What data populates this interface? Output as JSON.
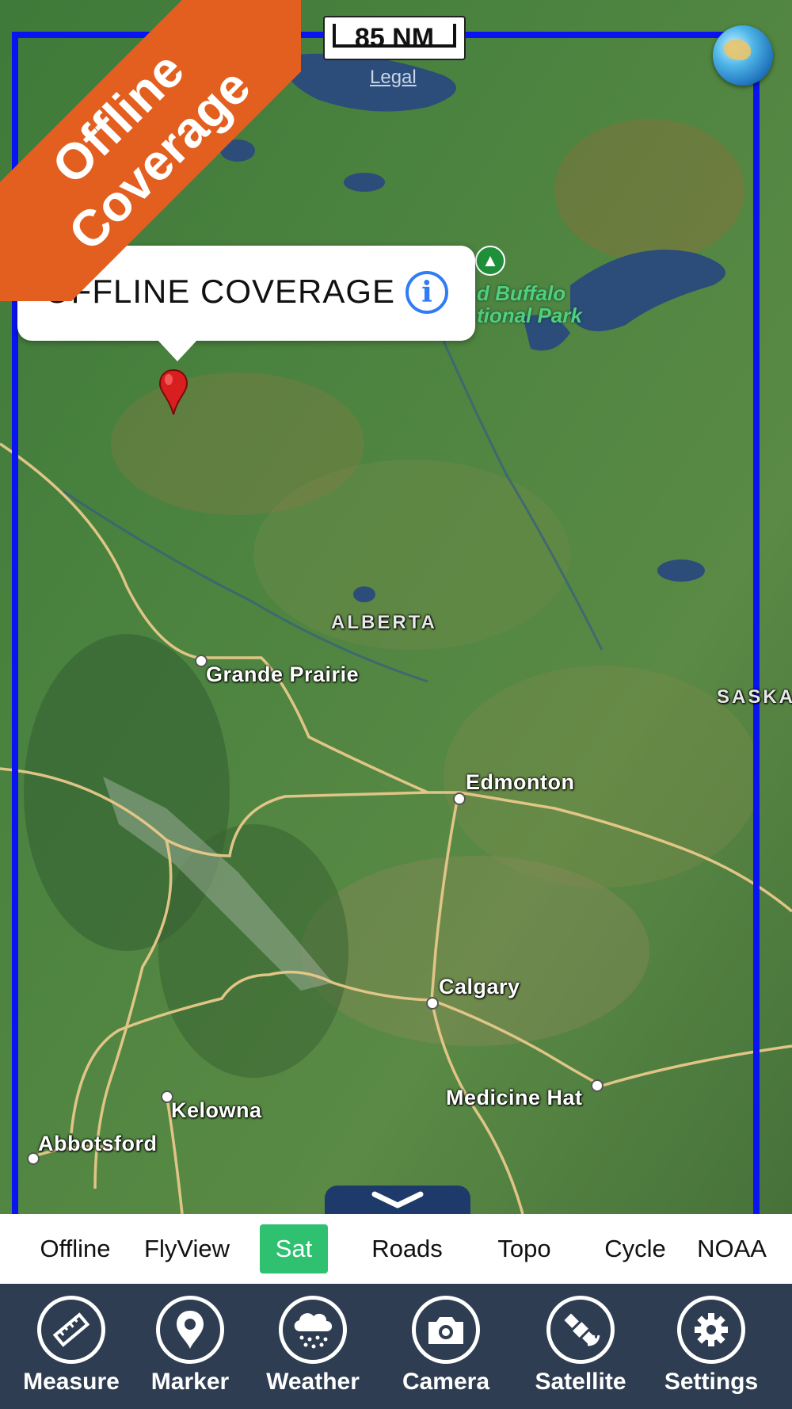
{
  "map": {
    "scale_label": "85 NM",
    "legal_label": "Legal",
    "ribbon_lines": [
      "Offline",
      "Coverage"
    ],
    "callout_title": "OFFLINE COVERAGE",
    "info_label": "i",
    "province_label": "ALBERTA",
    "province_label_2": "SASKA",
    "park_label_line1": "d Buffalo",
    "park_label_line2": "tional Park",
    "cities": [
      "Grande Prairie",
      "Edmonton",
      "Calgary",
      "Medicine Hat",
      "Kelowna",
      "Abbotsford"
    ]
  },
  "map_types": {
    "items": [
      "Offline",
      "FlyView",
      "Sat",
      "Roads",
      "Topo",
      "Cycle",
      "NOAA"
    ],
    "active": "Sat",
    "active_color": "#2fc070"
  },
  "toolbar": {
    "items": [
      {
        "label": "Measure",
        "icon": "ruler-icon"
      },
      {
        "label": "Marker",
        "icon": "map-pin-icon"
      },
      {
        "label": "Weather",
        "icon": "rain-cloud-icon"
      },
      {
        "label": "Camera",
        "icon": "camera-icon"
      },
      {
        "label": "Satellite",
        "icon": "satellite-icon"
      },
      {
        "label": "Settings",
        "icon": "gear-icon"
      }
    ],
    "background_color": "#2e3d51"
  },
  "colors": {
    "coverage_border": "#0a14f0",
    "ribbon": "#e35f1f",
    "info_blue": "#2e7cf6"
  }
}
